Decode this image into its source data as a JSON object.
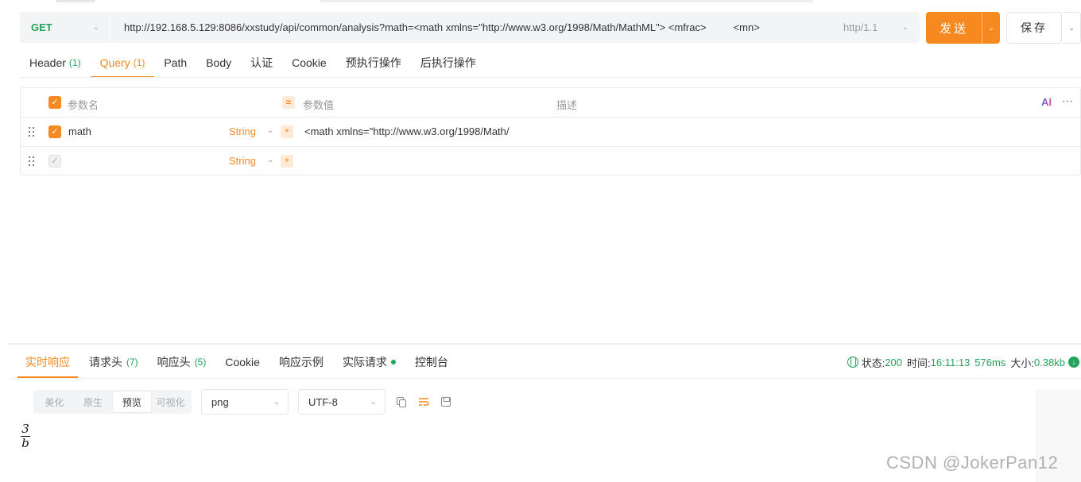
{
  "request": {
    "method": "GET",
    "url": "http://192.168.5.129:8086/xxstudy/api/common/analysis?math=<math xmlns=\"http://www.w3.org/1998/Math/MathML\"> <mfrac>",
    "url_tail": "<mn>",
    "protocol": "http/1.1",
    "send_label": "发送",
    "save_label": "保存"
  },
  "request_tabs": [
    {
      "label": "Header",
      "count": "(1)"
    },
    {
      "label": "Query",
      "count": "(1)"
    },
    {
      "label": "Path",
      "count": ""
    },
    {
      "label": "Body",
      "count": ""
    },
    {
      "label": "认证",
      "count": ""
    },
    {
      "label": "Cookie",
      "count": ""
    },
    {
      "label": "预执行操作",
      "count": ""
    },
    {
      "label": "后执行操作",
      "count": ""
    }
  ],
  "params_table": {
    "header": {
      "name": "参数名",
      "value": "参数值",
      "description": "描述",
      "ai": "AI"
    },
    "rows": [
      {
        "name": "math",
        "type": "String",
        "value": "<math xmlns=\"http://www.w3.org/1998/Math/",
        "checked": true
      },
      {
        "name": "",
        "type": "String",
        "value": "",
        "checked": false
      }
    ]
  },
  "response_tabs": [
    {
      "label": "实时响应",
      "count": ""
    },
    {
      "label": "请求头",
      "count": "(7)"
    },
    {
      "label": "响应头",
      "count": "(5)"
    },
    {
      "label": "Cookie",
      "count": ""
    },
    {
      "label": "响应示例",
      "count": ""
    },
    {
      "label": "实际请求",
      "count": ""
    },
    {
      "label": "控制台",
      "count": ""
    }
  ],
  "status": {
    "status_label": "状态:",
    "status_code": "200",
    "time_label": "时间:",
    "time_value": "16:11:13",
    "duration": "576ms",
    "size_label": "大小:",
    "size_value": "0.38kb"
  },
  "view_modes": [
    "美化",
    "原生",
    "预览",
    "可视化"
  ],
  "active_view": "预览",
  "format": "png",
  "encoding": "UTF-8",
  "preview": {
    "numerator": "3",
    "denominator": "b"
  },
  "watermark": "CSDN @JokerPan12",
  "colors": {
    "accent": "#f6891f",
    "success": "#23a45a"
  }
}
